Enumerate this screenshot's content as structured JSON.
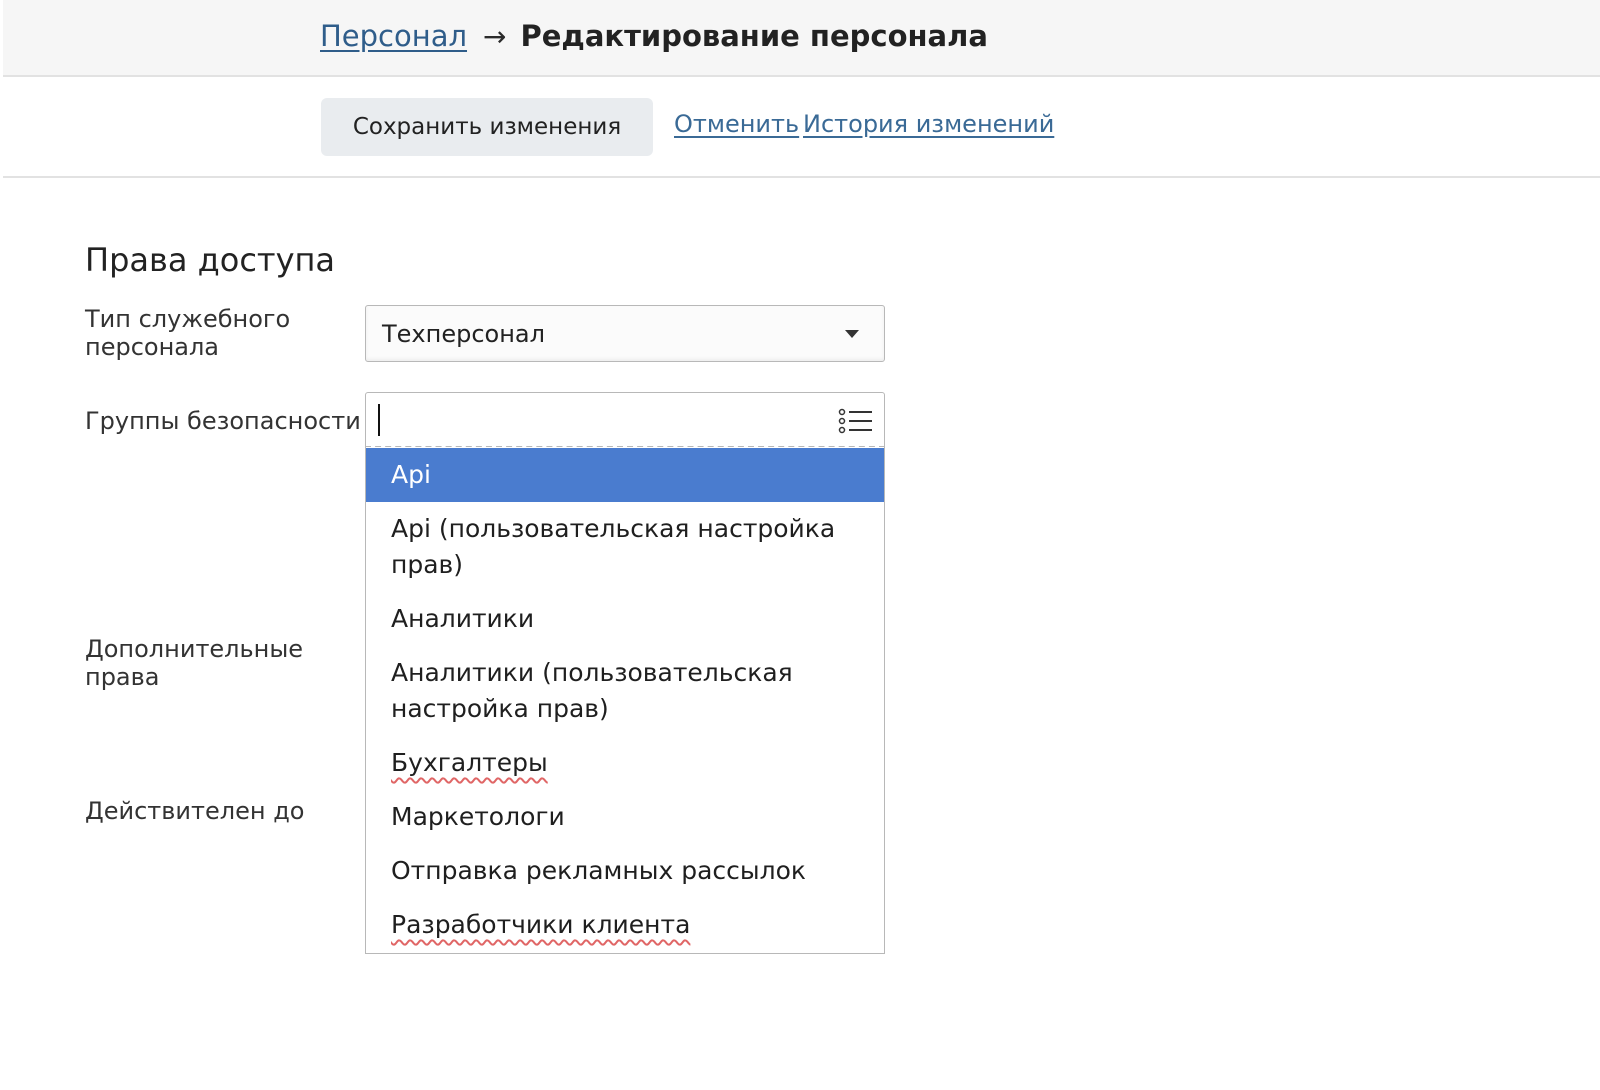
{
  "breadcrumb": {
    "parent": "Персонал",
    "arrow": "→",
    "current": "Редактирование персонала"
  },
  "toolbar": {
    "save_label": "Сохранить изменения",
    "cancel_label": "Отменить",
    "history_label": "История изменений"
  },
  "form": {
    "section_title": "Права доступа",
    "type_label": "Тип служебного персонала",
    "type_value": "Техперсонал",
    "groups_label": "Группы безопасности",
    "groups_input_value": "",
    "extra_rights_label": "Дополнительные права",
    "valid_until_label": "Действителен до"
  },
  "groups_dropdown": {
    "selected_index": 0,
    "options": [
      {
        "label": "Api"
      },
      {
        "label": "Api (пользовательская настройка прав)"
      },
      {
        "label": "Аналитики"
      },
      {
        "label": "Аналитики (пользовательская настройка прав)"
      },
      {
        "label": "Бухгалтеры"
      },
      {
        "label": "Маркетологи"
      },
      {
        "label": "Отправка рекламных рассылок"
      },
      {
        "label": "Разработчики клиента"
      }
    ]
  },
  "icons": {
    "select_caret": "caret-down-icon",
    "groups_list": "list-icon"
  },
  "colors": {
    "link": "#2f5d8a",
    "selected_option_bg": "#4a7ccf",
    "spellcheck_underline": "#e06666"
  }
}
